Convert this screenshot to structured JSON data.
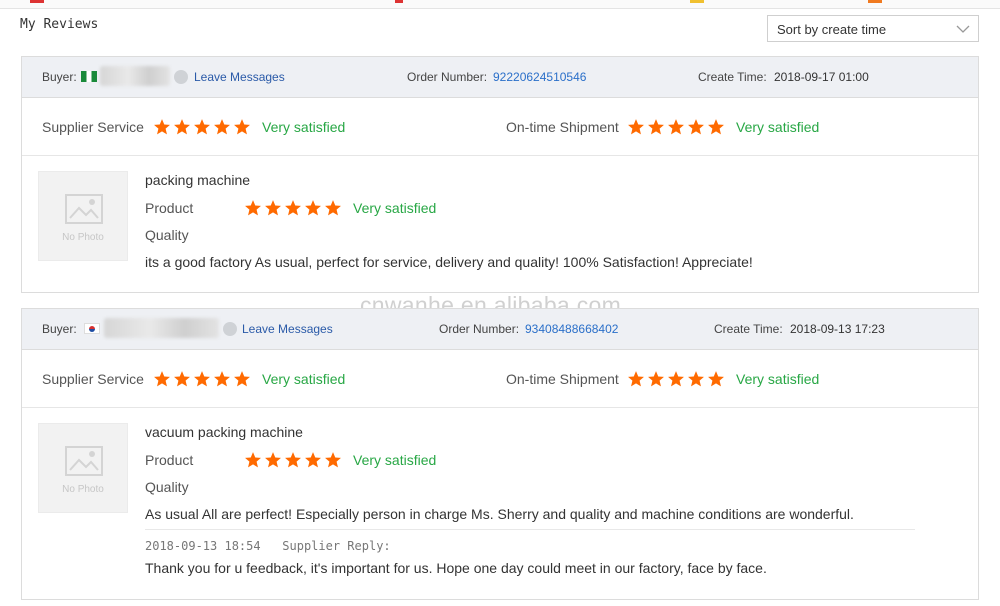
{
  "page": {
    "title": "My Reviews",
    "sort": {
      "selected": "Sort by create time"
    },
    "watermark": "cnwanhe.en.alibaba.com"
  },
  "colors": {
    "star": "#ff6a00",
    "satisfied": "#28a745",
    "link": "#2a5aa8",
    "header_bg": "#eef0f4"
  },
  "reviews": [
    {
      "buyer_label": "Buyer:",
      "buyer_flag": "ng",
      "leave_messages": "Leave Messages",
      "order_label": "Order Number:",
      "order_number": "92220624510546",
      "create_label": "Create Time:",
      "create_time": "2018-09-17 01:00",
      "supplier_service": {
        "label": "Supplier Service",
        "stars": 5,
        "verdict": "Very satisfied"
      },
      "ontime_shipment": {
        "label": "On-time Shipment",
        "stars": 5,
        "verdict": "Very satisfied"
      },
      "product_name": "packing machine",
      "product_rating": {
        "label": "Product",
        "stars": 5,
        "verdict": "Very satisfied"
      },
      "quality_label": "Quality",
      "comment": "its a good factory As usual, perfect for service, delivery and quality! 100% Satisfaction! Appreciate!",
      "no_photo": "No Photo"
    },
    {
      "buyer_label": "Buyer:",
      "buyer_flag": "kr",
      "leave_messages": "Leave Messages",
      "order_label": "Order Number:",
      "order_number": "93408488668402",
      "create_label": "Create Time:",
      "create_time": "2018-09-13 17:23",
      "supplier_service": {
        "label": "Supplier Service",
        "stars": 5,
        "verdict": "Very satisfied"
      },
      "ontime_shipment": {
        "label": "On-time Shipment",
        "stars": 5,
        "verdict": "Very satisfied"
      },
      "product_name": "vacuum packing machine",
      "product_rating": {
        "label": "Product",
        "stars": 5,
        "verdict": "Very satisfied"
      },
      "quality_label": "Quality",
      "comment": "As usual All are perfect! Especially person in charge Ms. Sherry and quality and machine conditions are wonderful.",
      "no_photo": "No Photo",
      "reply_date": "2018-09-13 18:54",
      "reply_label": "Supplier Reply:",
      "reply_text": "Thank you for u feedback, it's important for us. Hope one day could meet in our factory, face by face."
    }
  ]
}
